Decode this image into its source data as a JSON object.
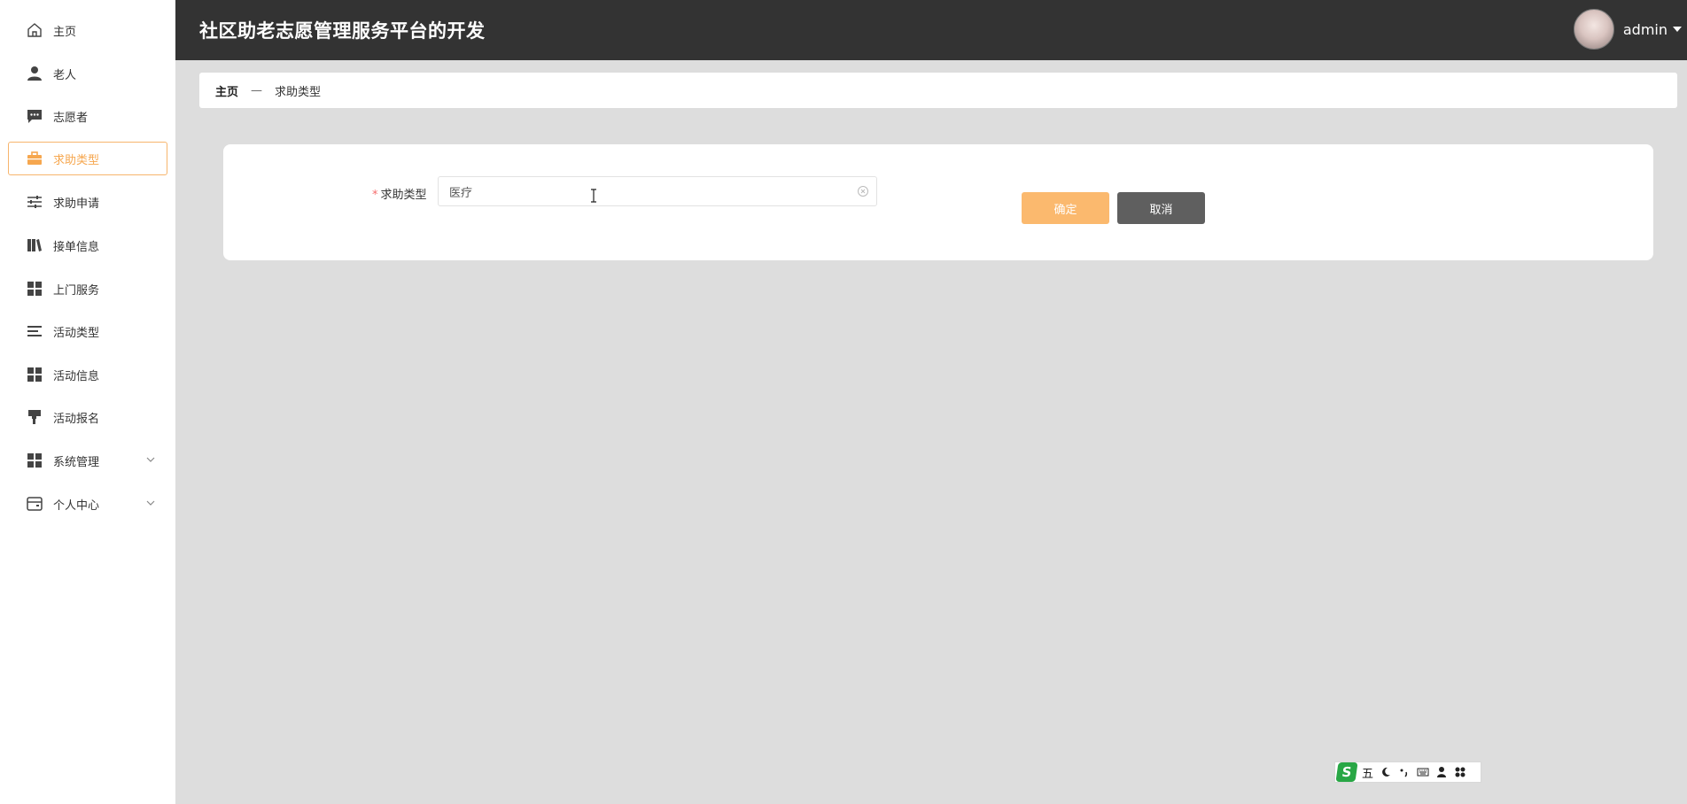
{
  "sidebar": {
    "items": [
      {
        "label": "主页",
        "icon": "home-icon"
      },
      {
        "label": "老人",
        "icon": "user-icon"
      },
      {
        "label": "志愿者",
        "icon": "chat-icon"
      },
      {
        "label": "求助类型",
        "icon": "briefcase-icon",
        "active": true
      },
      {
        "label": "求助申请",
        "icon": "sliders-icon"
      },
      {
        "label": "接单信息",
        "icon": "books-icon"
      },
      {
        "label": "上门服务",
        "icon": "grid-icon"
      },
      {
        "label": "活动类型",
        "icon": "list-icon"
      },
      {
        "label": "活动信息",
        "icon": "grid-icon"
      },
      {
        "label": "活动报名",
        "icon": "brush-icon"
      },
      {
        "label": "系统管理",
        "icon": "grid-icon",
        "expandable": true
      },
      {
        "label": "个人中心",
        "icon": "wallet-icon",
        "expandable": true
      }
    ]
  },
  "header": {
    "title": "社区助老志愿管理服务平台的开发",
    "username": "admin"
  },
  "breadcrumb": {
    "home": "主页",
    "separator": "—",
    "current": "求助类型"
  },
  "form": {
    "field_label": "求助类型",
    "required_mark": "*",
    "field_value": "医疗",
    "confirm_label": "确定",
    "cancel_label": "取消"
  },
  "ime": {
    "logo": "S",
    "mode": "五"
  },
  "colors": {
    "accent": "#f6a74f",
    "header_bg": "#333333",
    "page_bg": "#dddddd",
    "confirm_bg": "#fbb96e",
    "cancel_bg": "#5f5f5f"
  }
}
